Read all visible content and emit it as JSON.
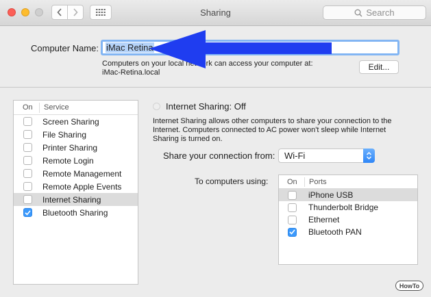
{
  "window": {
    "title": "Sharing"
  },
  "search": {
    "placeholder": "Search"
  },
  "computer_name": {
    "label": "Computer Name:",
    "value": "iMac Retina",
    "description_line1": "Computers on your local network can access your computer at:",
    "description_line2": "iMac-Retina.local",
    "edit_label": "Edit..."
  },
  "services": {
    "header_on": "On",
    "header_service": "Service",
    "items": [
      {
        "label": "Screen Sharing",
        "checked": false
      },
      {
        "label": "File Sharing",
        "checked": false
      },
      {
        "label": "Printer Sharing",
        "checked": false
      },
      {
        "label": "Remote Login",
        "checked": false
      },
      {
        "label": "Remote Management",
        "checked": false
      },
      {
        "label": "Remote Apple Events",
        "checked": false
      },
      {
        "label": "Internet Sharing",
        "checked": false,
        "selected": true
      },
      {
        "label": "Bluetooth Sharing",
        "checked": true
      }
    ]
  },
  "internet_sharing": {
    "title": "Internet Sharing: Off",
    "description": "Internet Sharing allows other computers to share your connection to the Internet. Computers connected to AC power won't sleep while Internet Sharing is turned on.",
    "share_from_label": "Share your connection from:",
    "share_from_value": "Wi-Fi",
    "to_computers_label": "To computers using:",
    "ports_header_on": "On",
    "ports_header_ports": "Ports",
    "ports": [
      {
        "label": "iPhone USB",
        "checked": false,
        "selected": true
      },
      {
        "label": "Thunderbolt Bridge",
        "checked": false
      },
      {
        "label": "Ethernet",
        "checked": false
      },
      {
        "label": "Bluetooth PAN",
        "checked": true
      }
    ]
  },
  "watermark": "HowTo",
  "colors": {
    "accent": "#3b99fc",
    "arrow": "#1f3df0",
    "focus_ring": "#82b5f3"
  }
}
